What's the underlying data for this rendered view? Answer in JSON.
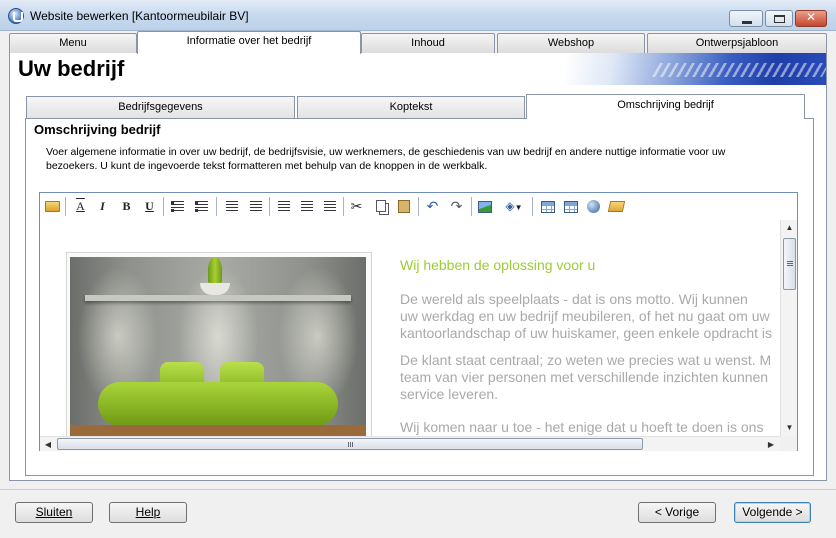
{
  "window": {
    "title": "Website bewerken [Kantoormeubilair BV]"
  },
  "main_tabs": [
    "Menu",
    "Informatie over het bedrijf",
    "Inhoud",
    "Webshop",
    "Ontwerpsjabloon"
  ],
  "header": {
    "title": "Uw bedrijf"
  },
  "sub_tabs": [
    "Bedrijfsgegevens",
    "Koptekst",
    "Omschrijving bedrijf"
  ],
  "section": {
    "title": "Omschrijving bedrijf",
    "description_line1": "Voer algemene informatie in over uw bedrijf, de bedrijfsvisie, uw werknemers, de geschiedenis van uw bedrijf en andere nuttige informatie voor uw",
    "description_line2": "bezoekers. U kunt de ingevoerde tekst formatteren met behulp van de knoppen in de werkbalk."
  },
  "editor": {
    "heading": "Wij hebben de oplossing voor u",
    "paragraphs": [
      [
        "De wereld als speelplaats - dat is ons motto. Wij kunnen",
        "uw werkdag en uw bedrijf meubileren, of het nu gaat om uw",
        "kantoorlandschap of uw huiskamer, geen enkele opdracht is"
      ],
      [
        "De klant staat centraal; zo weten we precies wat u wenst. M",
        "team van vier personen met verschillende inzichten kunnen",
        "service leveren."
      ],
      [
        "Wij komen naar u toe - het enige dat u hoeft te doen is ons"
      ]
    ]
  },
  "buttons": {
    "close": "Sluiten",
    "help": "Help",
    "previous": "< Vorige",
    "next": "Volgende >"
  },
  "colors": {
    "heading_green": "#9acd32",
    "paragraph_gray": "#a9a9a9"
  }
}
